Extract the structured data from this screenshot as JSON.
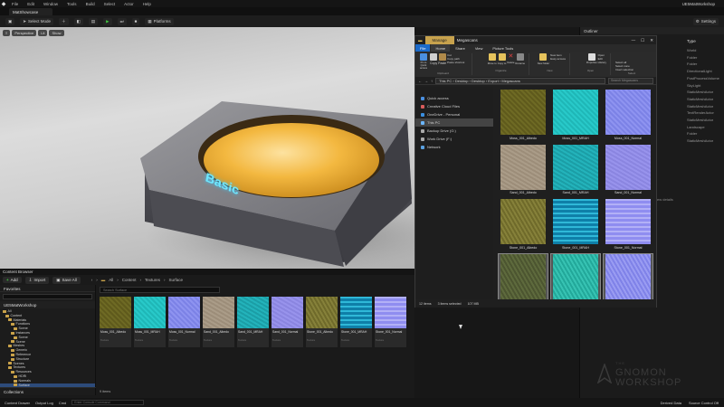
{
  "menubar": {
    "items": [
      "File",
      "Edit",
      "Window",
      "Tools",
      "Build",
      "Select",
      "Actor",
      "Help"
    ],
    "title": "UE5MatWorkshop"
  },
  "tab": {
    "label": "MatShowcase"
  },
  "toolbar": {
    "select_mode": "Select Mode",
    "platforms": "Platforms",
    "settings": "Settings"
  },
  "viewport": {
    "buttons": [
      "Perspective",
      "Lit",
      "Show"
    ],
    "label3d": "Basic"
  },
  "explorer": {
    "title": "Megascans",
    "manage": "Manage",
    "ribbon_tabs": [
      "File",
      "Home",
      "Share",
      "View",
      "Picture Tools"
    ],
    "ribbon": {
      "groups": [
        "Clipboard",
        "Organize",
        "New",
        "Open",
        "Select"
      ],
      "items": [
        "Pin to Quick access",
        "Copy",
        "Paste",
        "Cut",
        "Copy path",
        "Paste shortcut",
        "Move to",
        "Copy to",
        "Delete",
        "Rename",
        "New folder",
        "New item",
        "Easy access",
        "Properties",
        "Open",
        "Edit",
        "History",
        "Select all",
        "Select none",
        "Invert selection"
      ]
    },
    "address": [
      "This PC",
      "Desktop",
      "Desktop",
      "Export",
      "Megascans"
    ],
    "search": "Search Megascans",
    "nav": [
      "Quick access",
      "Creative Cloud Files",
      "OneDrive - Personal",
      "This PC",
      "Backup Drive (G:)",
      "Work Drive (F:)",
      "Network"
    ],
    "files": [
      {
        "name": "Moss_001_Albedo",
        "tex": "t-mossA"
      },
      {
        "name": "Moss_001_MRAH",
        "tex": "t-mossM"
      },
      {
        "name": "Moss_001_Normal",
        "tex": "t-mossN"
      },
      {
        "name": "Sand_001_Albedo",
        "tex": "t-sandA"
      },
      {
        "name": "Sand_001_MRAH",
        "tex": "t-sandM"
      },
      {
        "name": "Sand_001_Normal",
        "tex": "t-sandN"
      },
      {
        "name": "Stone_001_Albedo",
        "tex": "t-stoneA"
      },
      {
        "name": "Stone_001_MRAH",
        "tex": "t-stoneM"
      },
      {
        "name": "Stone_001_Normal",
        "tex": "t-stoneN"
      },
      {
        "name": "Stone_002_Albedo",
        "tex": "t-stone2A"
      },
      {
        "name": "Stone_002_MRAH",
        "tex": "t-stone2M"
      },
      {
        "name": "Stone_002_Normal",
        "tex": "t-stone2N"
      }
    ],
    "status": {
      "count": "12 items",
      "selected": "3 items selected",
      "size": "107 MB"
    }
  },
  "outliner": {
    "title": "Outliner",
    "type_header": "Type",
    "types": [
      "World",
      "Folder",
      "Folder",
      "DirectionalLight",
      "PostProcessVolume",
      "SkyLight",
      "StaticMeshActor",
      "StaticMeshActor",
      "StaticMeshActor",
      "TextRenderActor",
      "StaticMeshActor",
      "Landscape",
      "Folder",
      "StaticMeshActor"
    ]
  },
  "details": {
    "hint": "ew details"
  },
  "content_browser": {
    "tab": "Content Browser",
    "add": "Add",
    "import": "Import",
    "save_all": "Save All",
    "crumbs": [
      "All",
      "Content",
      "Textures",
      "Surface"
    ],
    "favorites": "Favorites",
    "project": "UE5MatWorkshop",
    "search": "Search Surface",
    "collections": "Collections",
    "item_count": "9 items",
    "tree": [
      "All",
      "Content",
      "Materials",
      "Functions",
      "Scene",
      "Instances",
      "Scene",
      "Scene",
      "Meshes",
      "Generic",
      "Reference",
      "Structure",
      "Scenes",
      "Textures",
      "Resources",
      "HDRI",
      "Normals",
      "Surface"
    ],
    "assets": [
      {
        "name": "Moss_001_Albedo",
        "kind": "Texture",
        "tex": "t-mossA"
      },
      {
        "name": "Moss_001_MRAH",
        "kind": "Texture",
        "tex": "t-mossM"
      },
      {
        "name": "Moss_001_Normal",
        "kind": "Texture",
        "tex": "t-mossN"
      },
      {
        "name": "Sand_001_Albedo",
        "kind": "Texture",
        "tex": "t-sandA"
      },
      {
        "name": "Sand_001_MRAH",
        "kind": "Texture",
        "tex": "t-sandM"
      },
      {
        "name": "Sand_001_Normal",
        "kind": "Texture",
        "tex": "t-sandN"
      },
      {
        "name": "Stone_001_Albedo",
        "kind": "Texture",
        "tex": "t-stoneA"
      },
      {
        "name": "Stone_001_MRAH",
        "kind": "Texture",
        "tex": "t-stoneM"
      },
      {
        "name": "Stone_001_Normal",
        "kind": "Texture",
        "tex": "t-stoneN"
      }
    ]
  },
  "bottombar": {
    "content_drawer": "Content Drawer",
    "output_log": "Output Log",
    "cmd": "Cmd",
    "cmd_placeholder": "Enter Console Command",
    "derived": "Derived Data",
    "source_control": "Source Control Off"
  },
  "watermark": {
    "line1": "THE",
    "line2": "GNOMON",
    "line3": "WORKSHOP"
  }
}
